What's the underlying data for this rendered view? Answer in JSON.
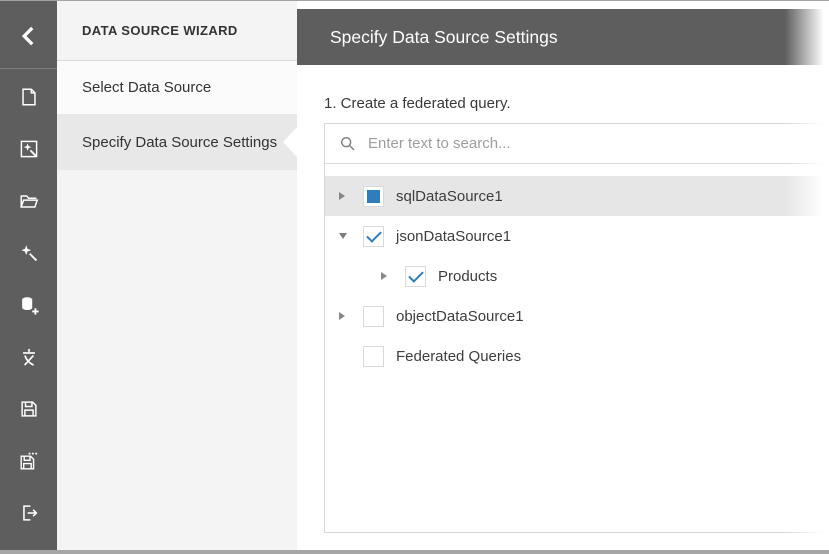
{
  "sidebar": {
    "back_icon": "back-chevron",
    "icons": [
      "new-report",
      "report-wizard",
      "open-report",
      "design-in-report-wizard",
      "add-data-source",
      "localization",
      "save",
      "save-as",
      "exit"
    ]
  },
  "wizard_nav": {
    "title": "DATA SOURCE WIZARD",
    "items": [
      {
        "label": "Select Data Source",
        "active": false
      },
      {
        "label": "Specify Data Source Settings",
        "active": true
      }
    ]
  },
  "main": {
    "header_title": "Specify Data Source Settings",
    "step_label": "1. Create a federated query.",
    "search": {
      "placeholder": "Enter text to search...",
      "value": ""
    },
    "tree": {
      "items": [
        {
          "label": "sqlDataSource1",
          "level": 0,
          "expander": "collapsed",
          "checkbox": "indeterminate",
          "selected": true
        },
        {
          "label": "jsonDataSource1",
          "level": 0,
          "expander": "expanded",
          "checkbox": "checked",
          "selected": false
        },
        {
          "label": "Products",
          "level": 1,
          "expander": "collapsed",
          "checkbox": "checked",
          "selected": false
        },
        {
          "label": "objectDataSource1",
          "level": 0,
          "expander": "collapsed",
          "checkbox": "unchecked",
          "selected": false
        },
        {
          "label": "Federated Queries",
          "level": 0,
          "expander": "none",
          "checkbox": "unchecked",
          "selected": false
        }
      ]
    }
  },
  "colors": {
    "chrome_gray": "#5e5e5e",
    "accent_blue": "#2e7dbc",
    "selected_row_bg": "#e6e6e6",
    "panel_bg": "#f4f4f4"
  }
}
